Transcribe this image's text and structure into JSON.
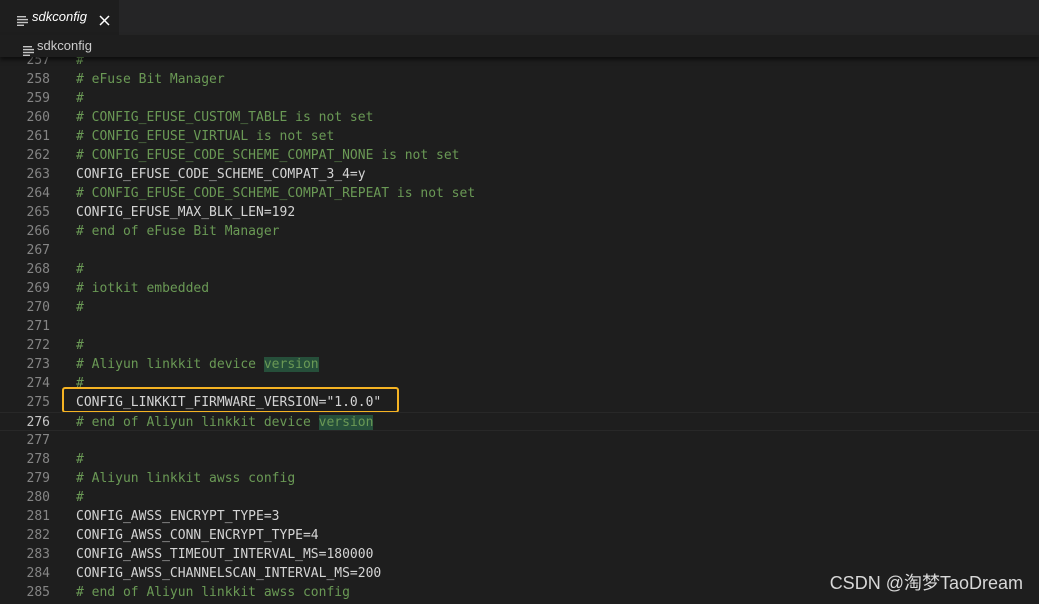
{
  "tab": {
    "label": "sdkconfig",
    "icon": "lines-file-icon",
    "close": "×"
  },
  "breadcrumb": {
    "label": "sdkconfig"
  },
  "current_line": "276",
  "highlight_phrase": "version",
  "lines": [
    {
      "n": "257",
      "text": "#"
    },
    {
      "n": "258",
      "text": "# eFuse Bit Manager"
    },
    {
      "n": "259",
      "text": "#"
    },
    {
      "n": "260",
      "text": "# CONFIG_EFUSE_CUSTOM_TABLE is not set"
    },
    {
      "n": "261",
      "text": "# CONFIG_EFUSE_VIRTUAL is not set"
    },
    {
      "n": "262",
      "text": "# CONFIG_EFUSE_CODE_SCHEME_COMPAT_NONE is not set"
    },
    {
      "n": "263",
      "text": "CONFIG_EFUSE_CODE_SCHEME_COMPAT_3_4=y"
    },
    {
      "n": "264",
      "text": "# CONFIG_EFUSE_CODE_SCHEME_COMPAT_REPEAT is not set"
    },
    {
      "n": "265",
      "text": "CONFIG_EFUSE_MAX_BLK_LEN=192"
    },
    {
      "n": "266",
      "text": "# end of eFuse Bit Manager"
    },
    {
      "n": "267",
      "text": ""
    },
    {
      "n": "268",
      "text": "#"
    },
    {
      "n": "269",
      "text": "# iotkit embedded"
    },
    {
      "n": "270",
      "text": "#"
    },
    {
      "n": "271",
      "text": ""
    },
    {
      "n": "272",
      "text": "#"
    },
    {
      "n": "273",
      "text": "# Aliyun linkkit device version"
    },
    {
      "n": "274",
      "text": "#"
    },
    {
      "n": "275",
      "text": "CONFIG_LINKKIT_FIRMWARE_VERSION=\"1.0.0\""
    },
    {
      "n": "276",
      "text": "# end of Aliyun linkkit device version"
    },
    {
      "n": "277",
      "text": ""
    },
    {
      "n": "278",
      "text": "#"
    },
    {
      "n": "279",
      "text": "# Aliyun linkkit awss config"
    },
    {
      "n": "280",
      "text": "#"
    },
    {
      "n": "281",
      "text": "CONFIG_AWSS_ENCRYPT_TYPE=3"
    },
    {
      "n": "282",
      "text": "CONFIG_AWSS_CONN_ENCRYPT_TYPE=4"
    },
    {
      "n": "283",
      "text": "CONFIG_AWSS_TIMEOUT_INTERVAL_MS=180000"
    },
    {
      "n": "284",
      "text": "CONFIG_AWSS_CHANNELSCAN_INTERVAL_MS=200"
    },
    {
      "n": "285",
      "text": "# end of Aliyun linkkit awss config"
    }
  ],
  "boxed_line": "275",
  "watermark": "CSDN @淘梦TaoDream",
  "colors": {
    "background": "#1e1e1e",
    "comment": "#6a9955",
    "text": "#d4d4d4",
    "line_number": "#858585",
    "box": "#f5b323"
  }
}
